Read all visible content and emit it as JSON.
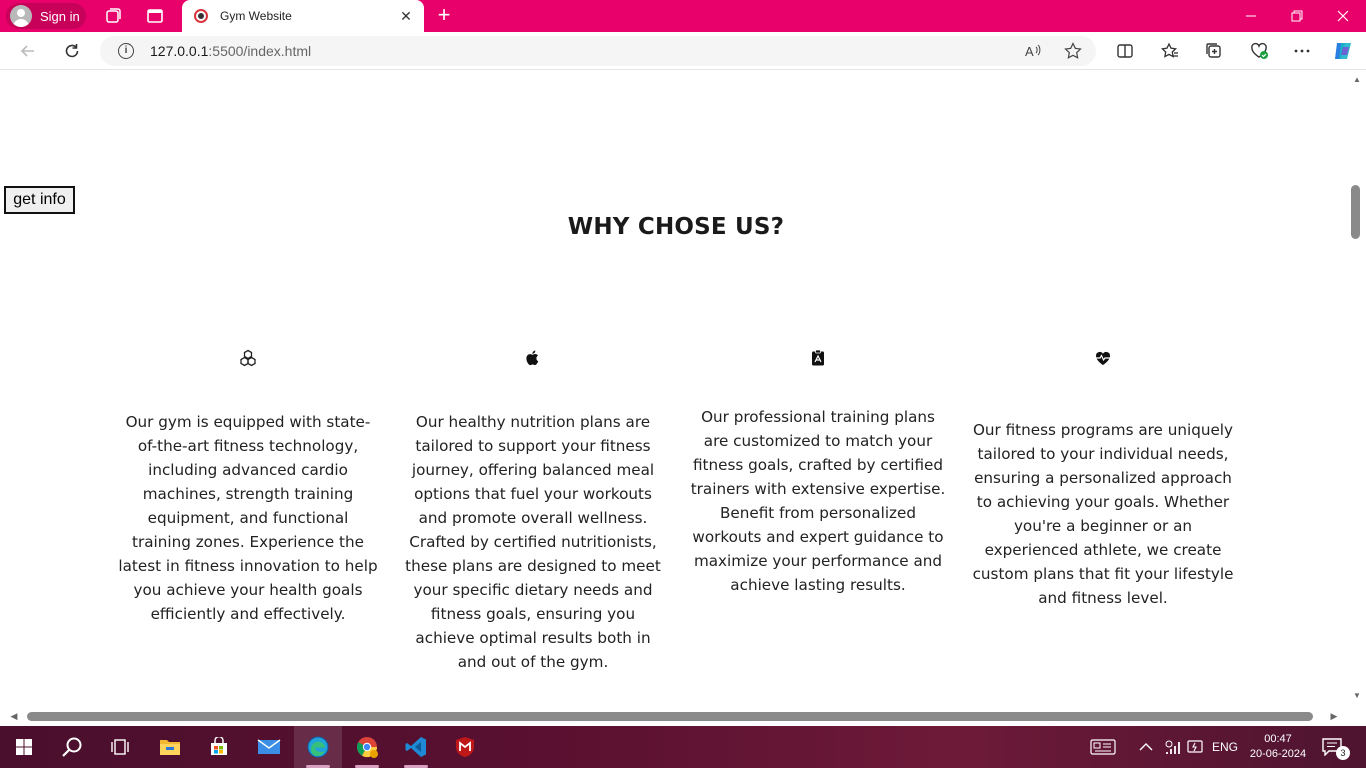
{
  "browser": {
    "signin_label": "Sign in",
    "tab_title": "Gym Website",
    "url_host": "127.0.0.1",
    "url_rest": ":5500/index.html"
  },
  "page": {
    "get_info_button": "get info",
    "heading": "WHY CHOSE US?",
    "features": [
      {
        "icon": "cubes-icon",
        "text": "Our gym is equipped with state-of-the-art fitness technology, including advanced cardio machines, strength training equipment, and functional training zones. Experience the latest in fitness innovation to help you achieve your health goals efficiently and effectively."
      },
      {
        "icon": "apple-icon",
        "text": "Our healthy nutrition plans are tailored to support your fitness journey, offering balanced meal options that fuel your workouts and promote overall wellness. Crafted by certified nutritionists, these plans are designed to meet your specific dietary needs and fitness goals, ensuring you achieve optimal results both in and out of the gym."
      },
      {
        "icon": "clipboard-icon",
        "text": "Our professional training plans are customized to match your fitness goals, crafted by certified trainers with extensive expertise. Benefit from personalized workouts and expert guidance to maximize your performance and achieve lasting results."
      },
      {
        "icon": "heart-pulse-icon",
        "text": "Our fitness programs are uniquely tailored to your individual needs, ensuring a personalized approach to achieving your goals. Whether you're a beginner or an experienced athlete, we create custom plans that fit your lifestyle and fitness level."
      }
    ]
  },
  "taskbar": {
    "language": "ENG",
    "time": "00:47",
    "date": "20-06-2024",
    "notification_count": "3"
  },
  "colors": {
    "browser_accent": "#e8006b",
    "taskbar": "#5a1030"
  }
}
